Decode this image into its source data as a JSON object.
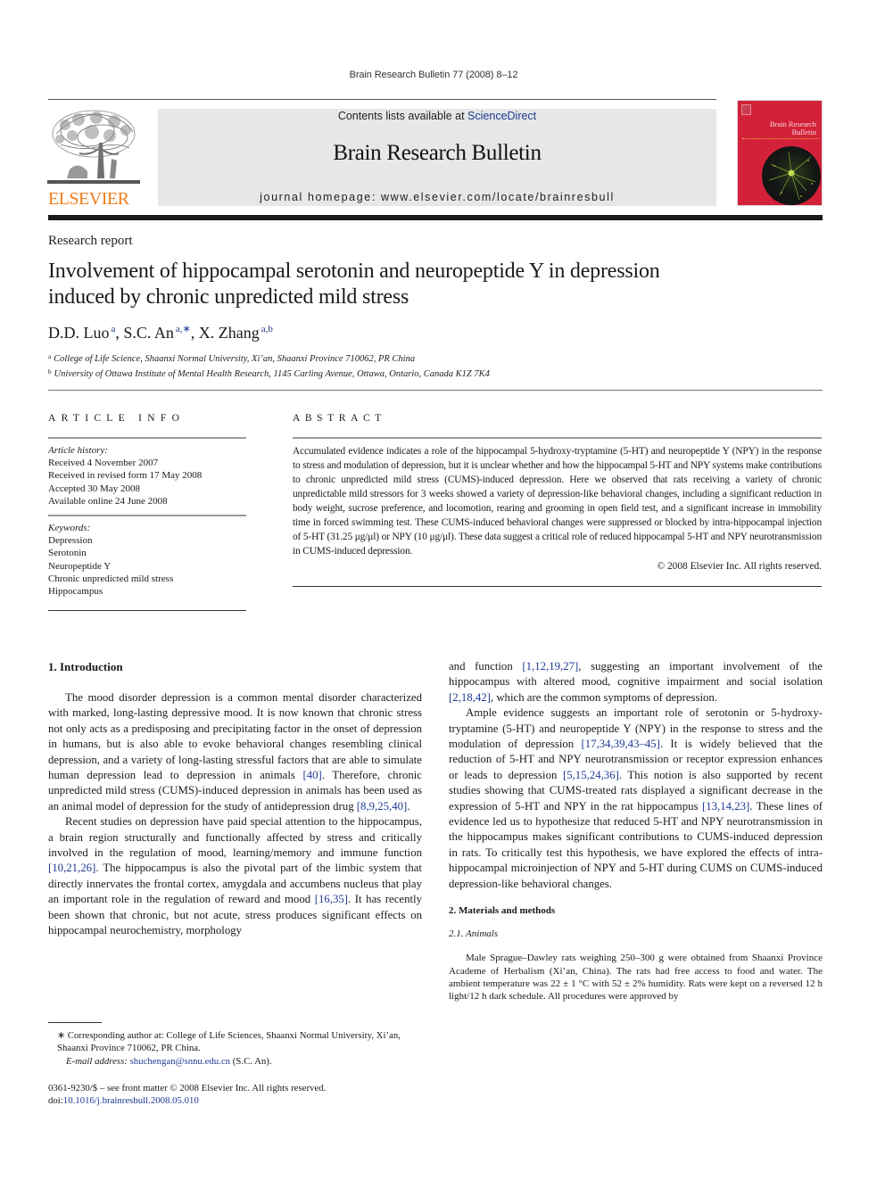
{
  "running_head": "Brain Research Bulletin 77 (2008) 8–12",
  "header": {
    "publisher_logo_icon": "elsevier-tree-icon",
    "publisher_name": "ELSEVIER",
    "contents_prefix": "Contents lists available at ",
    "contents_link": "ScienceDirect",
    "journal_title": "Brain Research Bulletin",
    "homepage": "journal homepage: www.elsevier.com/locate/brainresbull",
    "cover_title_line1": "Brain Research",
    "cover_title_line2": "Bulletin",
    "colors": {
      "elsevier_orange": "#f07d1a",
      "banner_gray": "#e6e7e8",
      "cover_red": "#d4213a",
      "link_blue": "#1f3a93"
    }
  },
  "article": {
    "type": "Research report",
    "title_line1": "Involvement of hippocampal serotonin and neuropeptide Y in depression",
    "title_line2": "induced by chronic unpredicted mild stress",
    "authors": [
      {
        "name": "D.D. Luo",
        "sup": "a"
      },
      {
        "name": "S.C. An",
        "sup": "a,∗"
      },
      {
        "name": "X. Zhang",
        "sup": "a,b"
      }
    ],
    "affiliations": [
      {
        "mark": "a",
        "text": "College of Life Science, Shaanxi Normal University, Xi’an, Shaanxi Province 710062, PR China"
      },
      {
        "mark": "b",
        "text": "University of Ottawa Institute of Mental Health Research, 1145 Carling Avenue, Ottawa, Ontario, Canada K1Z 7K4"
      }
    ]
  },
  "article_info": {
    "heading": "ARTICLE INFO",
    "history_label": "Article history:",
    "history": [
      "Received 4 November 2007",
      "Received in revised form 17 May 2008",
      "Accepted 30 May 2008",
      "Available online 24 June 2008"
    ],
    "keywords_label": "Keywords:",
    "keywords": [
      "Depression",
      "Serotonin",
      "Neuropeptide Y",
      "Chronic unpredicted mild stress",
      "Hippocampus"
    ]
  },
  "abstract": {
    "heading": "ABSTRACT",
    "text": "Accumulated evidence indicates a role of the hippocampal 5-hydroxy-tryptamine (5-HT) and neuropeptide Y (NPY) in the response to stress and modulation of depression, but it is unclear whether and how the hippocampal 5-HT and NPY systems make contributions to chronic unpredicted mild stress (CUMS)-induced depression. Here we observed that rats receiving a variety of chronic unpredictable mild stressors for 3 weeks showed a variety of depression-like behavioral changes, including a significant reduction in body weight, sucrose preference, and locomotion, rearing and grooming in open field test, and a significant increase in immobility time in forced swimming test. These CUMS-induced behavioral changes were suppressed or blocked by intra-hippocampal injection of 5-HT (31.25 μg/μl) or NPY (10 μg/μl). These data suggest a critical role of reduced hippocampal 5-HT and NPY neurotransmission in CUMS-induced depression.",
    "copyright": "© 2008 Elsevier Inc. All rights reserved."
  },
  "body": {
    "intro_heading": "1.  Introduction",
    "intro_p1": {
      "t1": "The mood disorder depression is a common mental disorder characterized with marked, long-lasting depressive mood. It is now known that chronic stress not only acts as a predisposing and precipitating factor in the onset of depression in humans, but is also able to evoke behavioral changes resembling clinical depression, and a variety of long-lasting stressful factors that are able to simulate human depression lead to depression in animals ",
      "c1": "[40]",
      "t2": ". Therefore, chronic unpredicted mild stress (CUMS)-induced depression in animals has been used as an animal model of depression for the study of antidepression drug ",
      "c2": "[8,9,25,40]",
      "t3": "."
    },
    "intro_p2": {
      "t1": "Recent studies on depression have paid special attention to the hippocampus, a brain region structurally and functionally affected by stress and critically involved in the regulation of mood, learning/memory and immune function ",
      "c1": "[10,21,26]",
      "t2": ". The hippocampus is also the pivotal part of the limbic system that directly innervates the frontal cortex, amygdala and accumbens nucleus that play an important role in the regulation of reward and mood ",
      "c2": "[16,35]",
      "t3": ". It has recently been shown that chronic, but not acute, stress produces significant effects on hippocampal neurochemistry, morphology"
    },
    "right_p1": {
      "t1": "and function ",
      "c1": "[1,12,19,27]",
      "t2": ", suggesting an important involvement of the hippocampus with altered mood, cognitive impairment and social isolation ",
      "c2": "[2,18,42]",
      "t3": ", which are the common symptoms of depression."
    },
    "right_p2": {
      "t1": "Ample evidence suggests an important role of serotonin or 5-hydroxy-tryptamine (5-HT) and neuropeptide Y (NPY) in the response to stress and the modulation of depression ",
      "c1": "[17,34,39,43–45]",
      "t2": ". It is widely believed that the reduction of 5-HT and NPY neurotransmission or receptor expression enhances or leads to depression ",
      "c2": "[5,15,24,36]",
      "t3": ". This notion is also supported by recent studies showing that CUMS-treated rats displayed a significant decrease in the expression of 5-HT and NPY in the rat hippocampus ",
      "c3": "[13,14,23]",
      "t4": ". These lines of evidence led us to hypothesize that reduced 5-HT and NPY neurotransmission in the hippocampus makes significant contributions to CUMS-induced depression in rats. To critically test this hypothesis, we have explored the effects of intra-hippocampal microinjection of NPY and 5-HT during CUMS on CUMS-induced depression-like behavioral changes."
    },
    "methods_heading": "2.  Materials and methods",
    "animals_heading": "2.1.  Animals",
    "animals_text": "Male Sprague–Dawley rats weighing 250–300 g were obtained from Shaanxi Province Academe of Herbalism (Xi’an, China). The rats had free access to food and water. The ambient temperature was 22 ± 1 °C with 52 ± 2% humidity. Rats were kept on a reversed 12 h light/12 h dark schedule. All procedures were approved by"
  },
  "footnote": {
    "corresponding": "∗  Corresponding author at: College of Life Sciences, Shaanxi Normal University, Xi’an, Shaanxi Province 710062, PR China.",
    "email_label": "E-mail address:",
    "email": "shuchengan@snnu.edu.cn",
    "email_suffix": " (S.C. An).",
    "front_matter": "0361-9230/$ – see front matter © 2008 Elsevier Inc. All rights reserved.",
    "doi_prefix": "doi:",
    "doi": "10.1016/j.brainresbull.2008.05.010"
  }
}
